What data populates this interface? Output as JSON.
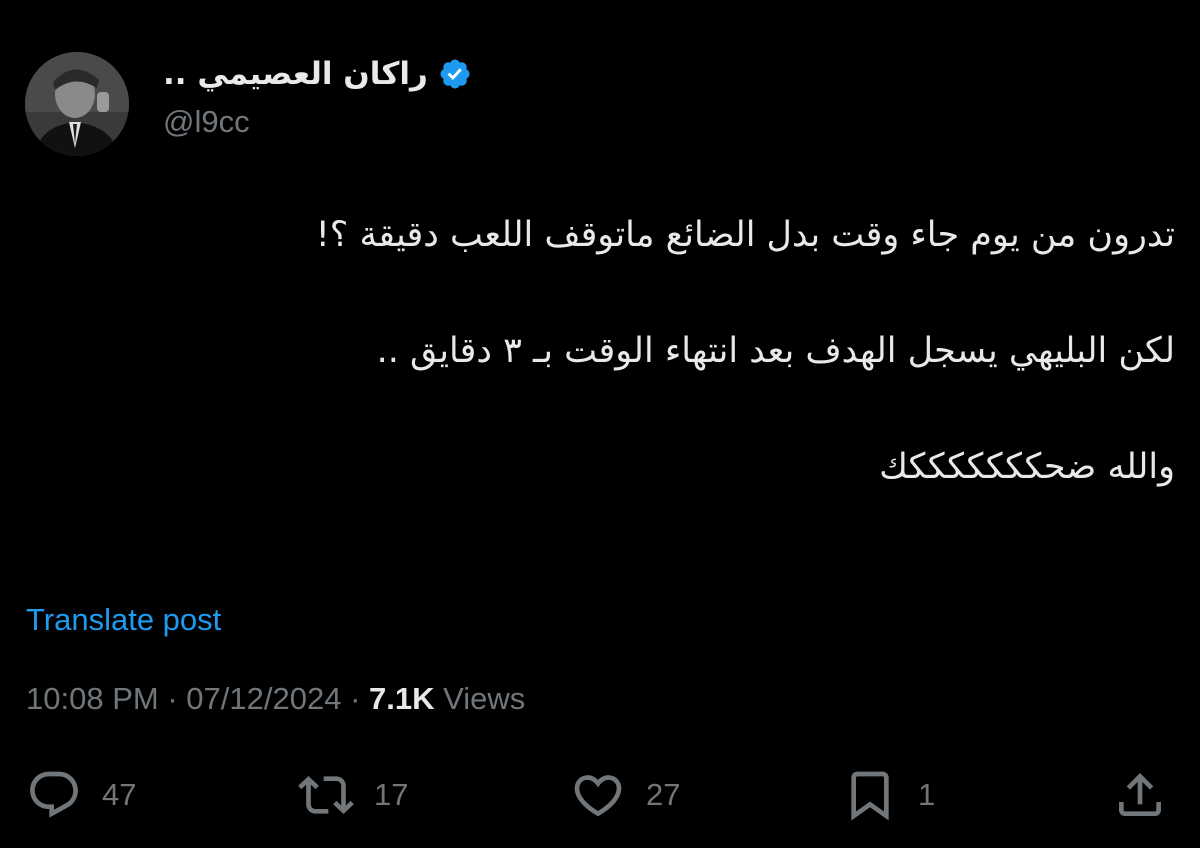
{
  "author": {
    "display_name": "راكان العصيمي ..",
    "handle": "@l9cc",
    "verified": true
  },
  "tweet": {
    "lines": [
      "تدرون من يوم جاء وقت بدل الضائع ماتوقف اللعب دقيقة ؟!",
      "لكن البليهي يسجل الهدف بعد انتهاء الوقت بـ ٣ دقايق ..",
      "والله ضحكككككككك"
    ]
  },
  "translate_label": "Translate post",
  "meta": {
    "time": "10:08 PM",
    "date": "07/12/2024",
    "separator": "·",
    "views_count": "7.1K",
    "views_label": "Views"
  },
  "actions": {
    "reply_count": "47",
    "retweet_count": "17",
    "like_count": "27",
    "bookmark_count": "1"
  },
  "colors": {
    "background": "#000000",
    "text": "#e7e9ea",
    "secondary": "#71767b",
    "accent": "#1d9bf0"
  },
  "icons": {
    "verified": "verified-badge-icon",
    "reply": "reply-icon",
    "retweet": "retweet-icon",
    "like": "heart-icon",
    "bookmark": "bookmark-icon",
    "share": "share-icon"
  }
}
